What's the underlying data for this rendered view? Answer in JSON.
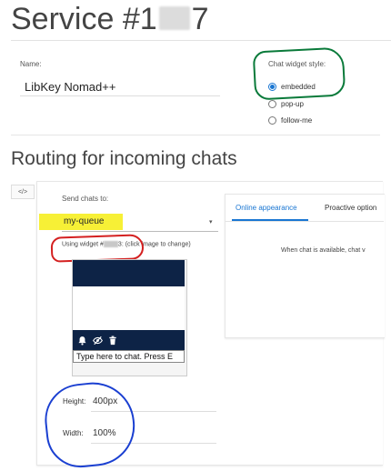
{
  "header": {
    "title_prefix": "Service #1",
    "title_suffix": "7"
  },
  "service": {
    "name_label": "Name:",
    "name_value": "LibKey Nomad++",
    "widget_style_label": "Chat widget style:",
    "style_options": [
      {
        "label": "embedded",
        "selected": true
      },
      {
        "label": "pop-up",
        "selected": false
      },
      {
        "label": "follow-me",
        "selected": false
      }
    ]
  },
  "routing": {
    "heading": "Routing for incoming chats",
    "code_toggle": "</>",
    "send_label": "Send chats to:",
    "queue_value": "my-queue",
    "queue_caret": "▾",
    "widget_note_prefix": "Using widget #",
    "widget_note_suffix": "3: (click image to change)",
    "preview_input_text": "Type here to chat. Press E",
    "height_label": "Height:",
    "height_value": "400px",
    "width_label": "Width:",
    "width_value": "100%"
  },
  "tabs": {
    "online": "Online appearance",
    "proactive": "Proactive option",
    "availability_text": "When chat is available, chat v"
  },
  "colors": {
    "accent": "#1976d2",
    "widget_navy": "#0d2346",
    "highlight_yellow": "#f7ef2b",
    "annotation_green": "#0a7a3a",
    "annotation_red": "#d42020",
    "annotation_blue": "#1a3fd1"
  }
}
